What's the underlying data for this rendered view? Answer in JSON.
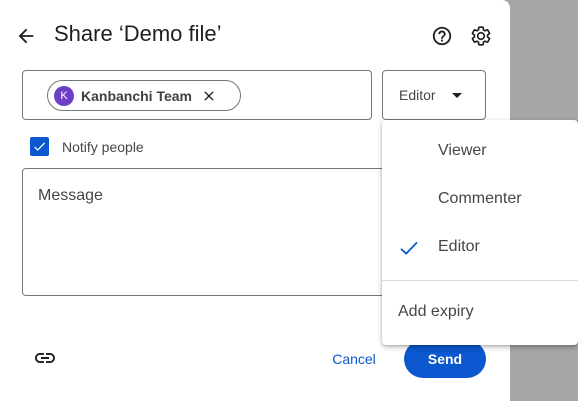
{
  "dialog": {
    "title": "Share ‘Demo file’"
  },
  "people_field": {
    "chip": {
      "avatar_initial": "K",
      "label": "Kanbanchi Team"
    }
  },
  "role_select": {
    "selected": "Editor"
  },
  "notify": {
    "label": "Notify people",
    "checked": true
  },
  "message": {
    "placeholder": "Message"
  },
  "actions": {
    "cancel_label": "Cancel",
    "send_label": "Send"
  },
  "role_menu": {
    "items": [
      {
        "label": "Viewer",
        "selected": false
      },
      {
        "label": "Commenter",
        "selected": false
      },
      {
        "label": "Editor",
        "selected": true
      }
    ],
    "expiry_label": "Add expiry"
  },
  "icons": {
    "back": "arrow-back-icon",
    "help": "help-circle-icon",
    "settings": "gear-icon",
    "remove_chip": "close-icon",
    "checkbox": "check-icon",
    "copy_link": "link-icon",
    "selected_role": "check-icon"
  },
  "colors": {
    "primary": "#0b57d0",
    "avatar": "#6d3fc7",
    "backdrop": "#a6a6a6"
  }
}
